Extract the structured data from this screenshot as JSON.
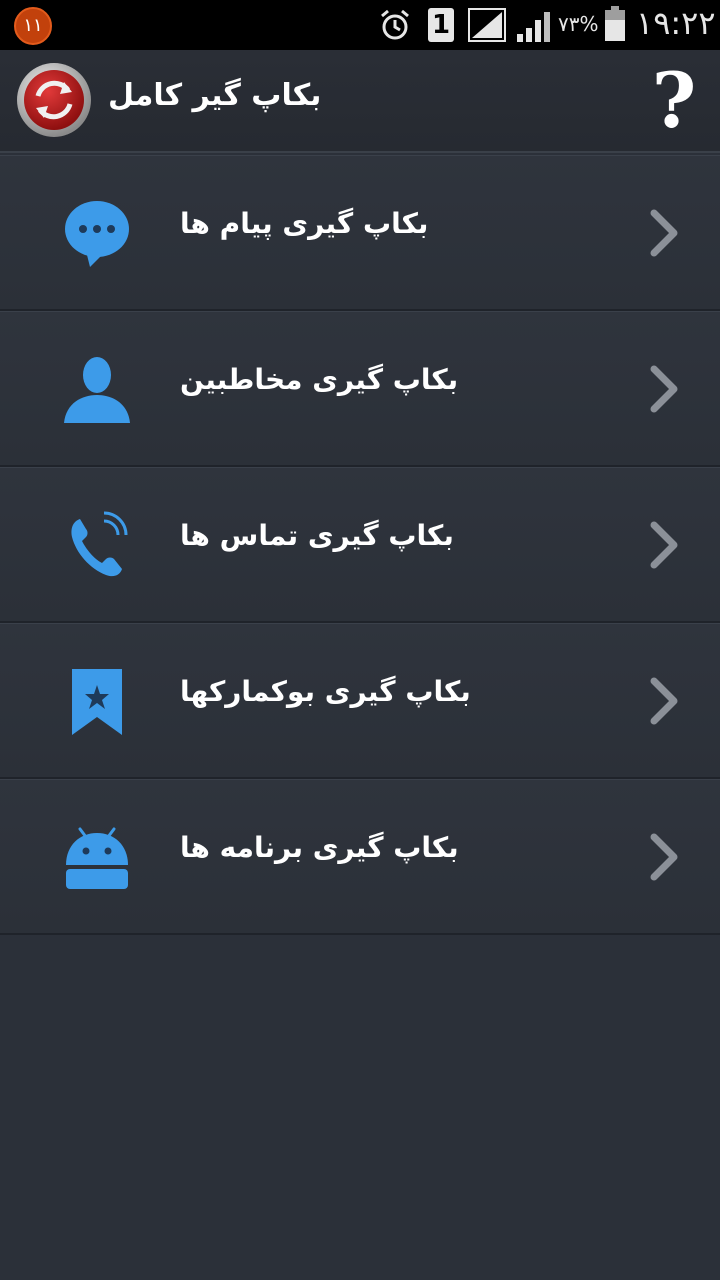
{
  "status_bar": {
    "notification_count": "۱۱",
    "battery_percent": "٧٣%",
    "time": "١٩:٢٢",
    "sim_label": "1",
    "icons": [
      "alarm-icon",
      "sim-icon",
      "signal-icon",
      "signal-icon",
      "battery-icon"
    ]
  },
  "header": {
    "title": "بکاپ گیر کامل",
    "help_label": "?",
    "logo_icon": "app-logo-icon"
  },
  "menu": {
    "items": [
      {
        "label": "بکاپ گیری پیام ها",
        "icon": "message-icon"
      },
      {
        "label": "بکاپ گیری مخاطبین",
        "icon": "contact-icon"
      },
      {
        "label": "بکاپ گیری تماس ها",
        "icon": "phone-icon"
      },
      {
        "label": "بکاپ گیری بوکمارکها",
        "icon": "bookmark-icon"
      },
      {
        "label": "بکاپ گیری برنامه ها",
        "icon": "android-icon"
      }
    ]
  },
  "colors": {
    "accent": "#3d9be9",
    "background": "#2b3039",
    "notification_badge": "#c2410c"
  }
}
